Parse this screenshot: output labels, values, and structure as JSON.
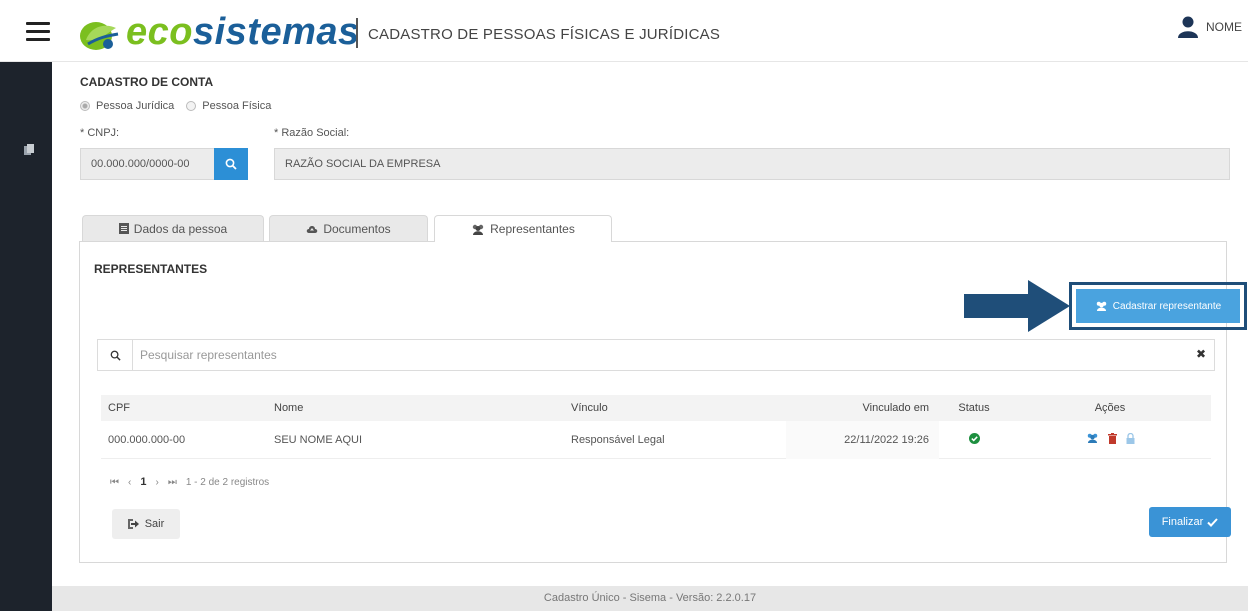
{
  "header": {
    "brand_eco": "eco",
    "brand_sistemas": "sistemas",
    "subtitle": "CADASTRO DE PESSOAS FÍSICAS E JURÍDICAS",
    "user_name": "NOME",
    "icons": {
      "menu": "hamburger-menu-icon",
      "logo": "eco-leaf-icon",
      "user": "user-icon"
    }
  },
  "sidebar": {
    "icons": [
      "document-icon"
    ]
  },
  "form": {
    "title": "CADASTRO DE CONTA",
    "person_type": {
      "options": [
        "Pessoa Jurídica",
        "Pessoa Física"
      ],
      "selected": "Pessoa Jurídica"
    },
    "cnpj_label": "* CNPJ:",
    "cnpj_placeholder": "00.000.000/0000-00",
    "razao_label": "* Razão Social:",
    "razao_value": "RAZÃO SOCIAL DA EMPRESA"
  },
  "tabs": [
    {
      "label": "Dados da pessoa",
      "icon": "file-icon"
    },
    {
      "label": "Documentos",
      "icon": "cloud-upload-icon"
    },
    {
      "label": "Representantes",
      "icon": "users-icon",
      "active": true
    }
  ],
  "representantes": {
    "title": "REPRESENTANTES",
    "register_button": "Cadastrar representante",
    "search_placeholder": "Pesquisar representantes",
    "columns": [
      "CPF",
      "Nome",
      "Vínculo",
      "Vinculado em",
      "Status",
      "Ações"
    ],
    "rows": [
      {
        "cpf": "000.000.000-00",
        "nome": "SEU NOME AQUI",
        "vinculo": "Responsável Legal",
        "vinculado_em": "22/11/2022 19:26",
        "status": "active",
        "actions": [
          "users-icon",
          "trash-icon",
          "lock-icon"
        ]
      }
    ],
    "pager": {
      "current_page": "1",
      "info": "1 - 2 de 2 registros"
    }
  },
  "buttons": {
    "sair": "Sair",
    "finalizar": "Finalizar"
  },
  "footer": {
    "text": "Cadastro Único - Sisema - Versão: 2.2.0.17"
  },
  "colors": {
    "brand_green": "#7bbf1f",
    "brand_blue": "#1b5f99",
    "primary": "#2c8fd6",
    "highlight_border": "#1f4e79",
    "sidebar": "#1d232c",
    "status_ok": "#1d8f3f",
    "delete": "#c0392b"
  }
}
